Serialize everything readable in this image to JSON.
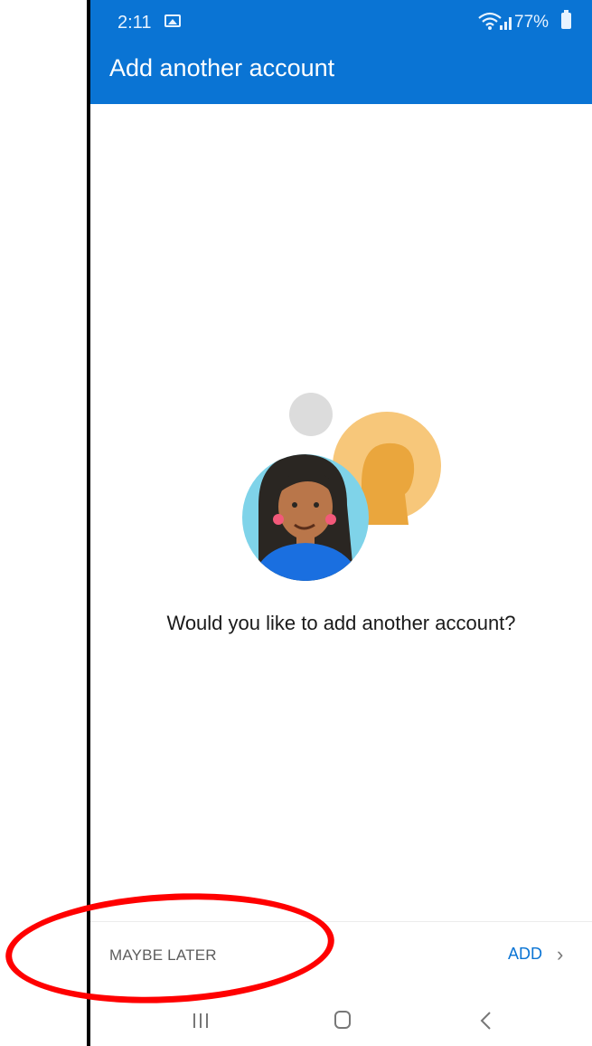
{
  "status_bar": {
    "time": "2:11",
    "battery": "77%"
  },
  "header": {
    "title": "Add another account"
  },
  "main": {
    "prompt": "Would you like to add another account?"
  },
  "footer": {
    "maybe_later_label": "MAYBE LATER",
    "add_label": "ADD",
    "add_chevron": "›"
  },
  "colors": {
    "header_bg": "#0a74d4",
    "accent": "#0a74d4",
    "annotation": "#ff0000"
  }
}
